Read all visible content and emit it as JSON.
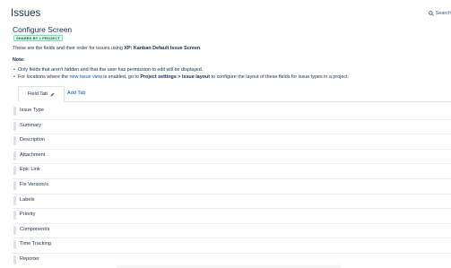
{
  "header": {
    "title": "Issues",
    "search_label": "Search"
  },
  "screen": {
    "title": "Configure Screen",
    "badge": "SHARED BY 1 PROJECT",
    "description_prefix": "These are the fields and their order for issues using ",
    "description_screen": "XP: Kanban Default Issue Screen",
    "description_suffix": "."
  },
  "note": {
    "label": "Note:",
    "items": [
      {
        "text": "Only fields that aren't hidden and that the user has permission to edit will be displayed."
      },
      {
        "pre": "For locations where the ",
        "link": "new issue view",
        "mid": " is enabled, go to ",
        "bold": "Project settings > Issue layout",
        "post": " to configure the layout of these fields for issue types in a project."
      }
    ]
  },
  "tabs": {
    "active": "Field Tab",
    "add": "Add Tab"
  },
  "fields": [
    "Issue Type",
    "Summary",
    "Description",
    "Attachment",
    "Epic Link",
    "Fix Version/s",
    "Labels",
    "Priority",
    "Component/s",
    "Time Tracking",
    "Reporter"
  ],
  "icons": {
    "search": "search-icon",
    "edit": "pencil-icon",
    "drag": "drag-handle-icon"
  },
  "colors": {
    "link": "#0052cc",
    "text": "#172b4d",
    "badge_bg": "#e3fcef",
    "badge_text": "#006644"
  }
}
